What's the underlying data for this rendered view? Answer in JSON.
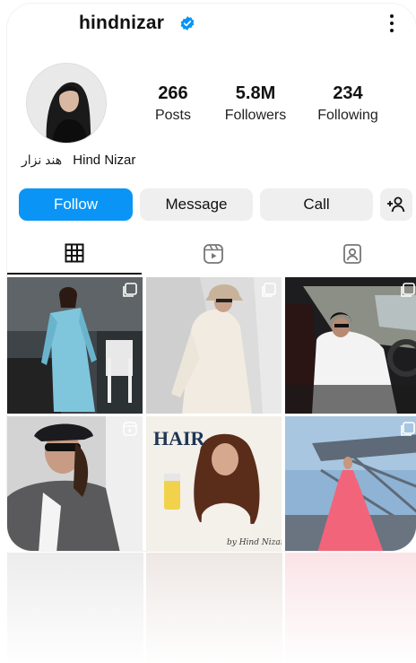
{
  "profile": {
    "username": "hindnizar",
    "display_name": "Hind Nizar",
    "display_name_arabic": "هند نزار"
  },
  "stats": {
    "posts": {
      "value": "266",
      "label": "Posts"
    },
    "followers": {
      "value": "5.8M",
      "label": "Followers"
    },
    "following": {
      "value": "234",
      "label": "Following"
    }
  },
  "actions": {
    "follow": "Follow",
    "message": "Message",
    "call": "Call"
  },
  "tabs": [
    "posts-grid",
    "reels",
    "tagged"
  ],
  "posts": [
    {
      "id": 1,
      "type": "multi",
      "scene": "woman in light blue gown in dining room"
    },
    {
      "id": 2,
      "type": "multi",
      "scene": "woman in cream fur coat and bucket hat"
    },
    {
      "id": 3,
      "type": "multi",
      "scene": "woman in white hoodie driving car"
    },
    {
      "id": 4,
      "type": "reel",
      "scene": "woman in cap and sunglasses, grey blazer"
    },
    {
      "id": 5,
      "type": "image",
      "scene": "hair product advertisement"
    },
    {
      "id": 6,
      "type": "multi",
      "scene": "woman in pink tulle gown on bridge"
    }
  ],
  "post5_text": {
    "brand": "HAIR",
    "signature": "by Hind Nizar"
  },
  "colors": {
    "follow_button": "#0a95f6",
    "secondary_button": "#efefef",
    "verified_badge": "#0095f6"
  },
  "icons": {
    "verified": "verified-badge-icon",
    "more": "more-options-icon",
    "add_user": "add-user-icon",
    "grid": "grid-icon",
    "reels": "reels-icon",
    "tagged": "tagged-icon"
  }
}
